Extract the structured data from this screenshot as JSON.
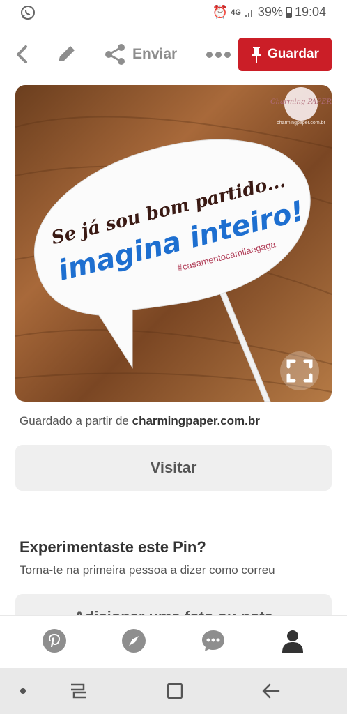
{
  "status_bar": {
    "network": "4G",
    "battery": "39%",
    "time": "19:04"
  },
  "toolbar": {
    "send_label": "Enviar",
    "save_label": "Guardar"
  },
  "pin": {
    "image_text_line1": "Se já sou bom partido...",
    "image_text_line2": "imagina inteiro!",
    "image_hashtag": "#casamentocamilaegaga",
    "logo_text": "Charming PAPER",
    "logo_url": "charmingpaper.com.br",
    "saved_from_prefix": "Guardado a partir de",
    "saved_from_domain": "charmingpaper.com.br",
    "visit_label": "Visitar"
  },
  "tried": {
    "title": "Experimentaste este Pin?",
    "subtitle": "Torna-te na primeira pessoa a dizer como correu",
    "add_label": "Adicionar uma foto ou nota"
  },
  "colors": {
    "brand_red": "#cb1e27",
    "blue_text": "#1e6fd0",
    "dark_text": "#3a1a14"
  }
}
